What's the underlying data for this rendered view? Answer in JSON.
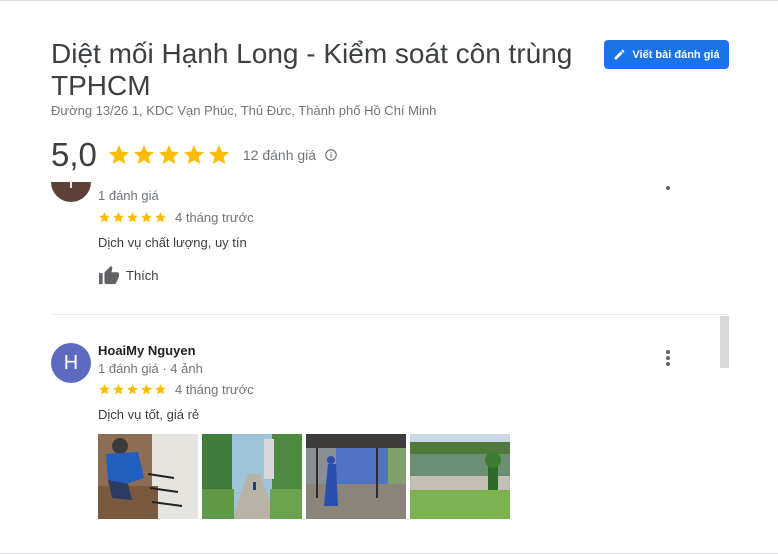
{
  "place": {
    "title": "Diệt mối Hạnh Long - Kiểm soát côn trùng TPHCM",
    "address": "Đường 13/26 1, KDC Vạn Phúc, Thủ Đức, Thành phố Hồ Chí Minh"
  },
  "actions": {
    "write_review_label": "Viết bài đánh giá"
  },
  "rating": {
    "score": "5,0",
    "stars": 5,
    "count_label": "12 đánh giá"
  },
  "reviews": [
    {
      "avatar_letter": "T",
      "meta": "1 đánh giá",
      "stars": 5,
      "time": "4 tháng trước",
      "text": "Dịch vụ chất lượng, uy tín",
      "like_label": "Thích"
    },
    {
      "avatar_letter": "H",
      "name": "HoaiMy Nguyen",
      "meta": "1 đánh giá · 4 ảnh",
      "stars": 5,
      "time": "4 tháng trước",
      "text": "Dịch vụ tốt, giá rẻ",
      "photo_count": 4
    }
  ],
  "colors": {
    "accent": "#1a73e8",
    "star": "#fbbc04",
    "avatar_review_1": "#5d4037",
    "avatar_review_2": "#5c6bc0"
  },
  "icons": {
    "write": "pencil-icon",
    "star": "star-icon",
    "info": "info-icon",
    "like": "thumb-up-icon",
    "more": "more-vertical-icon"
  }
}
